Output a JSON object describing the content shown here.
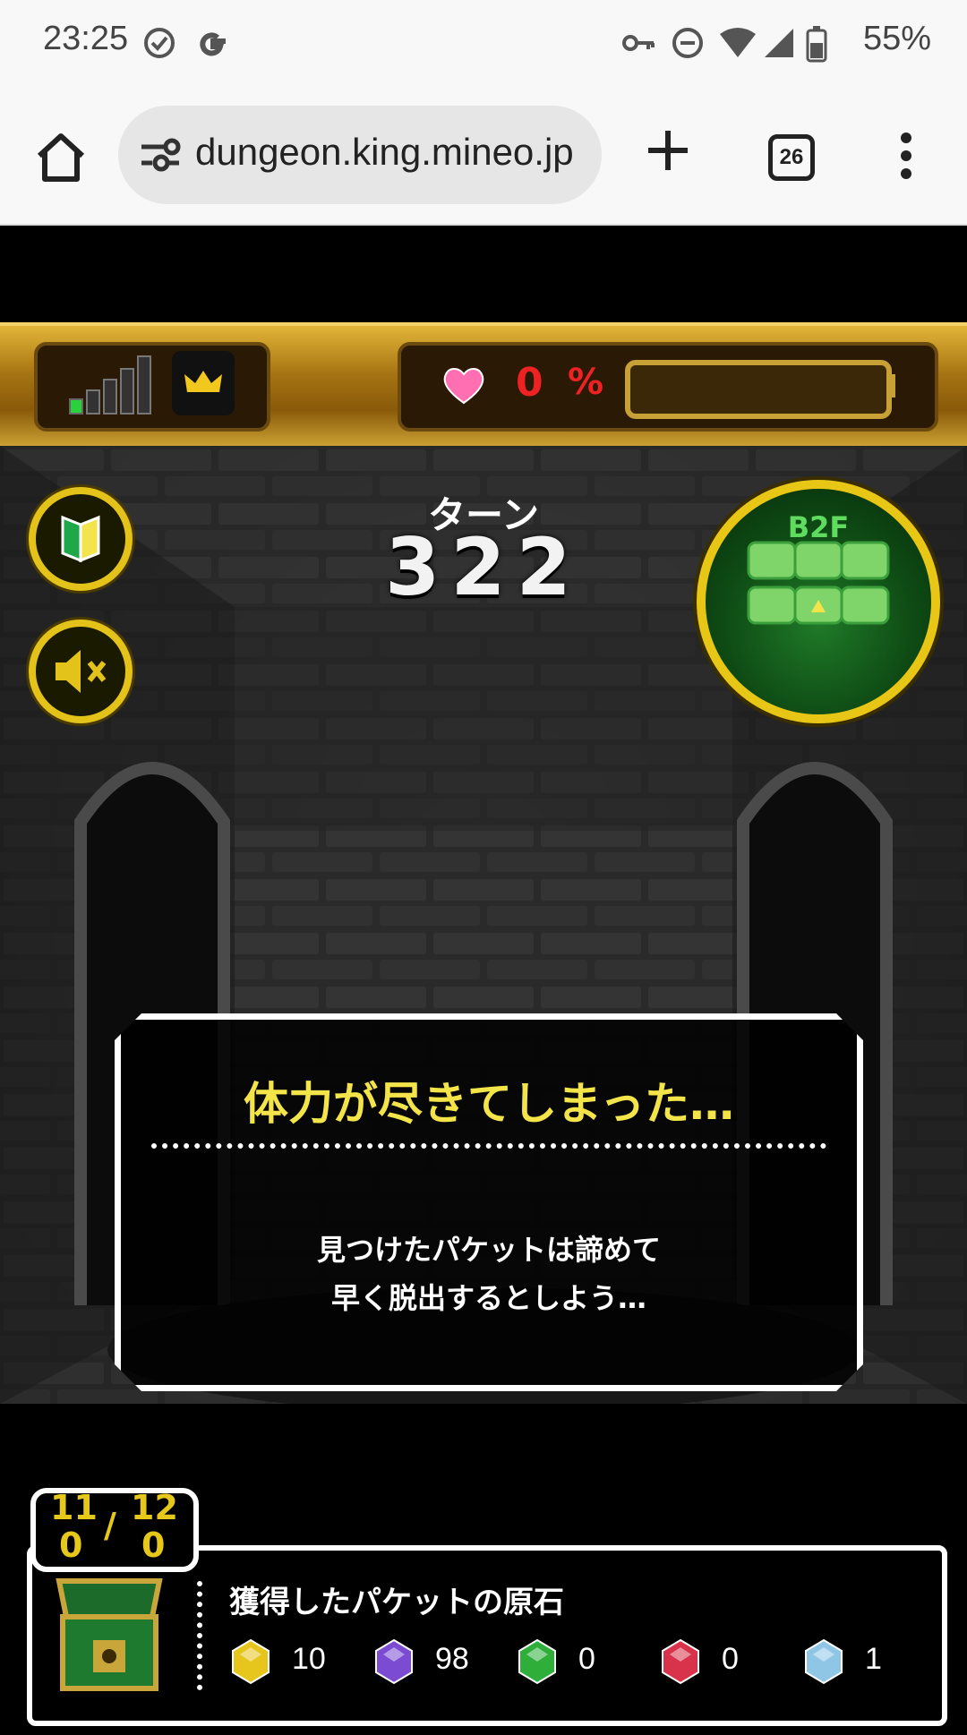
{
  "status_bar": {
    "time": "23:25",
    "battery": "55%"
  },
  "browser": {
    "url": "dungeon.king.mineo.jp",
    "tab_count": "26"
  },
  "hud": {
    "signal_bars_active": 1,
    "health_percent": "0",
    "percent_sign": "%",
    "health_fill": 0
  },
  "turn": {
    "label": "ターン",
    "value": "322"
  },
  "minimap": {
    "floor": "B2F"
  },
  "message": {
    "title": "体力が尽きてしまった…",
    "line1": "見つけたパケットは諦めて",
    "line2": "早く脱出するとしよう…"
  },
  "counter": {
    "top_left": "11",
    "top_right": "12",
    "slash": "/",
    "bottom_left": "0",
    "bottom_right": "0"
  },
  "packets": {
    "title": "獲得したパケットの原石",
    "gems": [
      {
        "icon": "yellow-gem-icon",
        "color": "#e6c51c",
        "count": "10"
      },
      {
        "icon": "purple-gem-icon",
        "color": "#7b4bd1",
        "count": "98"
      },
      {
        "icon": "green-gem-icon",
        "color": "#2fae3a",
        "count": "0"
      },
      {
        "icon": "red-gem-icon",
        "color": "#d8334a",
        "count": "0"
      },
      {
        "icon": "blue-gem-icon",
        "color": "#8fc6e6",
        "count": "1"
      }
    ]
  }
}
